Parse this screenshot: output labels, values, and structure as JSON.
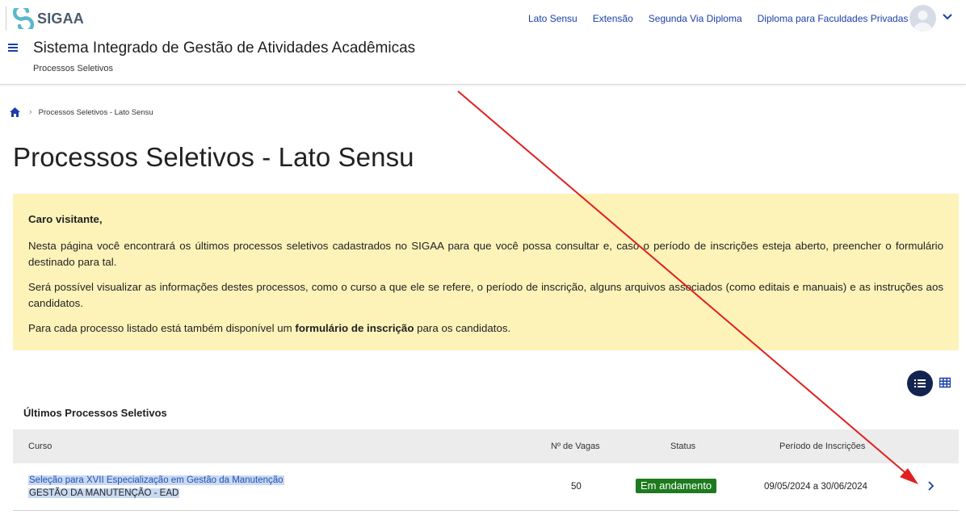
{
  "header": {
    "logo_text": "SIGAA",
    "nav": [
      "Lato Sensu",
      "Extensão",
      "Segunda Via Diploma",
      "Diploma para Faculdades Privadas"
    ],
    "system_title": "Sistema Integrado de Gestão de Atividades Acadêmicas",
    "system_subtitle": "Processos Seletivos"
  },
  "breadcrumb": {
    "current": "Processos Seletivos - Lato Sensu"
  },
  "page_title": "Processos Seletivos - Lato Sensu",
  "notice": {
    "greeting": "Caro visitante,",
    "p1": "Nesta página você encontrará os últimos processos seletivos cadastrados no SIGAA para que você possa consultar e, caso o período de inscrições esteja aberto, preencher o formulário destinado para tal.",
    "p2": "Será possível visualizar as informações destes processos, como o curso a que ele se refere, o período de inscrição, alguns arquivos associados (como editais e manuais) e as instruções aos candidatos.",
    "p3_before": "Para cada processo listado está também disponível um ",
    "p3_bold": "formulário de inscrição",
    "p3_after": " para os candidatos."
  },
  "section_title": "Últimos Processos Seletivos",
  "table": {
    "columns": {
      "curso": "Curso",
      "vagas": "Nº de Vagas",
      "status": "Status",
      "periodo": "Período de Inscrições"
    },
    "rows": [
      {
        "curso": "Seleção para XVII Especialização em Gestão da Manutenção",
        "curso_sub": "GESTÃO DA MANUTENÇÃO - EAD",
        "vagas": "50",
        "status": "Em andamento",
        "periodo": "09/05/2024 a 30/06/2024"
      }
    ]
  },
  "colors": {
    "accent": "#1a3fa8",
    "notice_bg": "#fdf3b9",
    "status_bg": "#1e7a1e",
    "annotation_arrow": "#e02020"
  },
  "icons": [
    "hamburger-icon",
    "home-icon",
    "chevron-right-icon",
    "list-view-icon",
    "grid-view-icon",
    "chevron-down-icon",
    "user-avatar-icon"
  ]
}
